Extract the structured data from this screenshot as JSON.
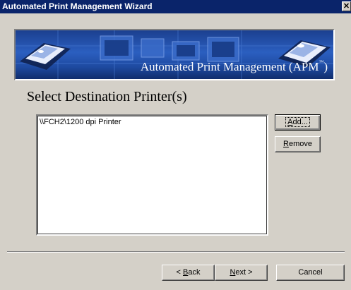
{
  "window": {
    "title": "Automated Print Management Wizard",
    "close_glyph": "✕"
  },
  "banner": {
    "title": "Automated Print Management (APM",
    "trademark": "™",
    "title_close": ")"
  },
  "page": {
    "heading": "Select Destination Printer(s)"
  },
  "printers": {
    "items": [
      "\\\\FCH2\\1200 dpi Printer"
    ]
  },
  "buttons": {
    "add": {
      "accel": "A",
      "rest": "dd..."
    },
    "remove": {
      "accel": "R",
      "rest": "emove"
    },
    "back": {
      "prefix": "< ",
      "accel": "B",
      "rest": "ack"
    },
    "next": {
      "accel": "N",
      "rest": "ext >"
    },
    "cancel": "Cancel"
  },
  "colors": {
    "titlebar": "#0a246a",
    "dialog_face": "#d4d0c8",
    "banner": "#2b5fc0"
  }
}
